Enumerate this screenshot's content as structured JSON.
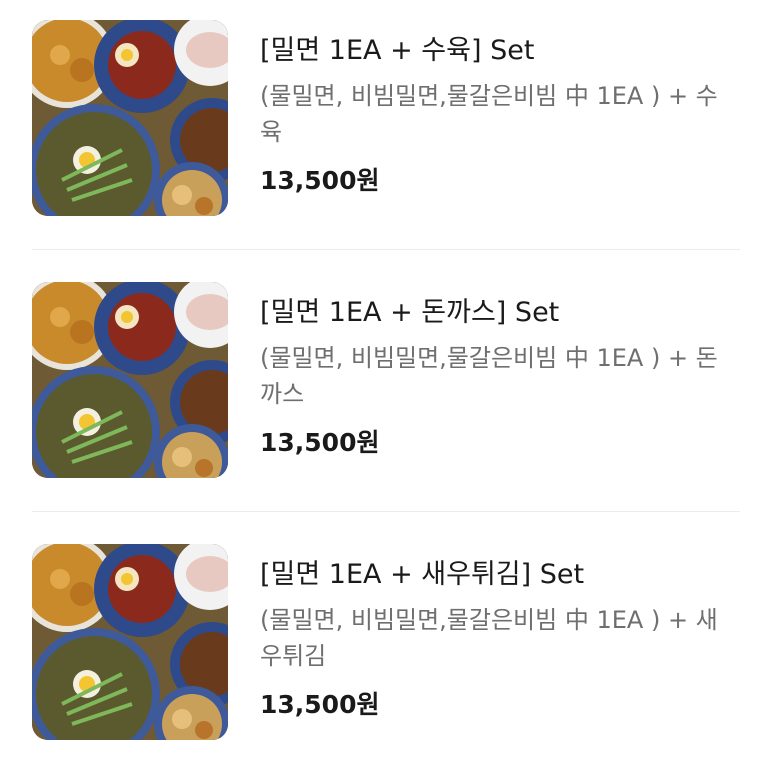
{
  "menu": {
    "items": [
      {
        "title": "[밀면 1EA + 수육] Set",
        "desc": "(물밀면, 비빔밀면,물갈은비빔 中 1EA ) + 수육",
        "price": "13,500원"
      },
      {
        "title": "[밀면 1EA + 돈까스] Set",
        "desc": "(물밀면, 비빔밀면,물갈은비빔 中 1EA ) + 돈까스",
        "price": "13,500원"
      },
      {
        "title": "[밀면 1EA + 새우튀김] Set",
        "desc": "(물밀면, 비빔밀면,물갈은비빔 中 1EA ) + 새우튀김",
        "price": "13,500원"
      }
    ]
  },
  "colors": {
    "title": "#1a1a1a",
    "desc": "#6f6f6f",
    "divider": "#ececec",
    "bowl_blue": "#2f4a8a"
  }
}
